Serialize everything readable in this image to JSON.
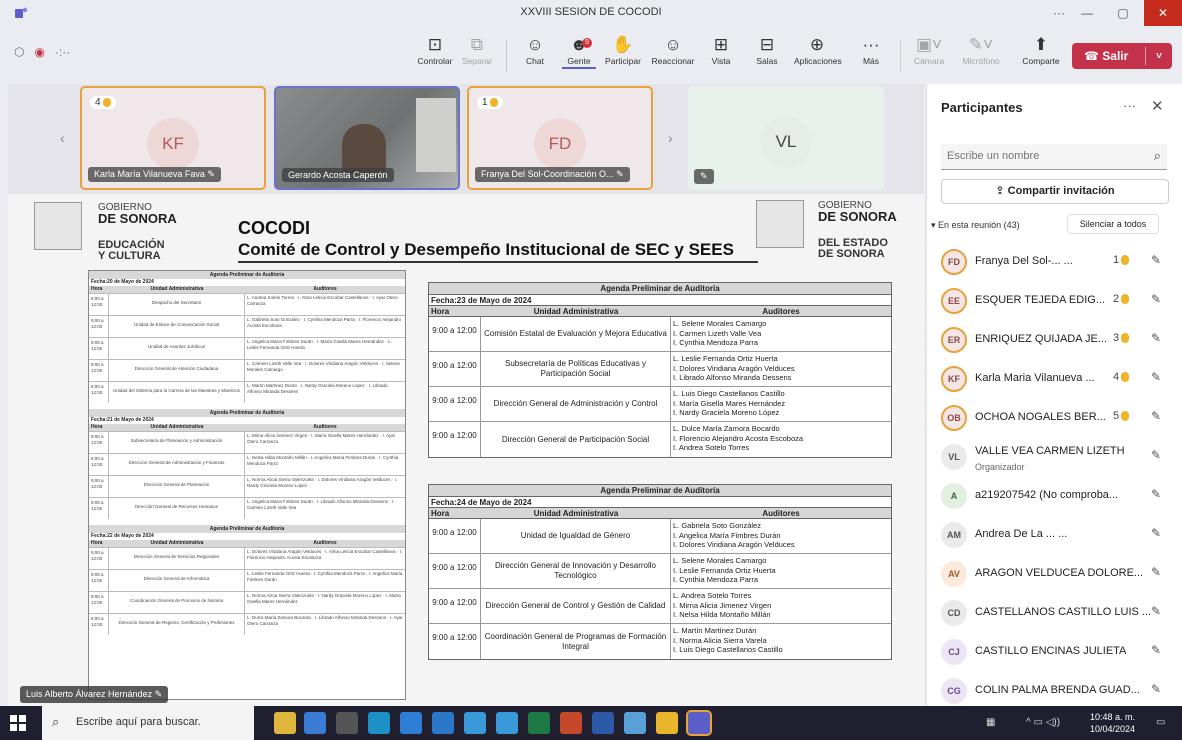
{
  "window": {
    "title": "XXVIII SESION DE COCODI",
    "controls": {
      "more": "···",
      "minimize": "—",
      "restore": "▢",
      "close": "✕"
    }
  },
  "toolbar": {
    "timer": "·:··",
    "buttons": [
      {
        "label": "Controlar",
        "icon": "control-icon"
      },
      {
        "label": "Separar",
        "icon": "popout-icon"
      },
      {
        "label": "Chat",
        "icon": "chat-icon"
      },
      {
        "label": "Gente",
        "icon": "people-icon"
      },
      {
        "label": "Participar",
        "icon": "raise-hand-icon"
      },
      {
        "label": "Reaccionar",
        "icon": "react-icon"
      },
      {
        "label": "Vista",
        "icon": "view-icon"
      },
      {
        "label": "Salas",
        "icon": "rooms-icon"
      },
      {
        "label": "Aplicaciones",
        "icon": "apps-icon"
      },
      {
        "label": "Más",
        "icon": "more-icon"
      },
      {
        "label": "Cámara",
        "icon": "camera-icon"
      },
      {
        "label": "Micrófono",
        "icon": "mic-icon"
      },
      {
        "label": "Comparte",
        "icon": "share-icon"
      }
    ],
    "people_badge": "9",
    "leave": "Salir"
  },
  "tiles": [
    {
      "initials": "KF",
      "name": "Karla María Vilanueva Fava",
      "hand": "4"
    },
    {
      "initials": "",
      "name": "Gerardo Acosta Caperón",
      "hand": ""
    },
    {
      "initials": "FD",
      "name": "Franya Del Sol-Coordinación O...",
      "hand": "1"
    },
    {
      "initials": "VL",
      "name": "",
      "hand": ""
    }
  ],
  "document": {
    "gov_left_1": "GOBIERNO",
    "gov_left_2": "DE SONORA",
    "org_left_1": "EDUCACIÓN",
    "org_left_2": "Y CULTURA",
    "title": "COCODI",
    "subtitle": "Comité de Control y Desempeño Institucional de SEC y SEES",
    "gov_right_1": "GOBIERNO",
    "gov_right_2": "DE SONORA",
    "org_right_1": "DEL ESTADO",
    "org_right_2": "DE SONORA",
    "mini_agenda_title": "Agenda Preliminar de Auditoría",
    "mini_sections": [
      {
        "date": "Fecha:20 de Mayo de 2024",
        "rows": [
          {
            "hour": "9:00 a 12:00",
            "unit": "Despacho del Secretario",
            "auditors": "L. Andrea Sotelo Torres · I. Alma Leticia Escobar Castellanos · I. Ayar Otero Carranza"
          },
          {
            "hour": "9:00 a 12:00",
            "unit": "Unidad de Enlace de Comunicación Social",
            "auditors": "L. Gabriela Soto González · I. Cynthia Mendoza Parra · I. Florencio Alejandro Acosta Escoboza"
          },
          {
            "hour": "9:00 a 12:00",
            "unit": "Unidad de Asuntos Jurídicos",
            "auditors": "L. Angelica María Fimbres Durán · I. María Gisella Mares Hernández · L. Leslie Fernanda Ortiz Huerta"
          },
          {
            "hour": "9:00 a 12:00",
            "unit": "Dirección General de Atención Ciudadana",
            "auditors": "L. Carmen Lizeth Valle Vea · I. Dolores Viridiana Aragón Velduces · I. Selene Morales Camargo"
          },
          {
            "hour": "9:00 a 12:00",
            "unit": "Unidad del Sistema para la Carrera de las Maestras y Maestros",
            "auditors": "L. Martín Martínez Durán · I. Nardy Graciela Moreno López · I. Librado Alfonso Miranda Dessens"
          }
        ]
      },
      {
        "date": "Fecha:21 de Mayo de 2024",
        "rows": [
          {
            "hour": "9:00 a 12:00",
            "unit": "Subsecretaría de Planeación y Administración",
            "auditors": "L. Mirna Alicia Jiménez Virgen · I. María Gisella Mares Hernández · I. Ayar Otero Carranza"
          },
          {
            "hour": "9:00 a 12:00",
            "unit": "Dirección General de Administración y Finanzas",
            "auditors": "L. Nelsa Hilda Montaño Millán · I. Angelica María Fimbres Durán · I. Cynthia Mendoza Parra"
          },
          {
            "hour": "9:00 a 12:00",
            "unit": "Dirección General de Planeación",
            "auditors": "L. Norma Alicia Sierra Valenzuela · I. Dolores Viridiana Aragón Velduces · I. Nardy Graciela Moreno López"
          },
          {
            "hour": "9:00 a 12:00",
            "unit": "Dirección General de Recursos Humanos",
            "auditors": "L. Angelica María Fimbres Durán · I. Librado Alfonso Miranda Dessens · I. Carmen Lizeth Valle Vea"
          }
        ]
      },
      {
        "date": "Fecha:22 de Mayo de 2024",
        "rows": [
          {
            "hour": "9:00 a 12:00",
            "unit": "Dirección General de Servicios Regionales",
            "auditors": "L. Dolores Viridiana Aragón Velduces · I. Alma Leticia Escobar Castellanos · I. Florencio Alejandro Acosta Escoboza"
          },
          {
            "hour": "9:00 a 12:00",
            "unit": "Dirección General de Informática",
            "auditors": "L. Leslie Fernanda Ortiz Huerta · I. Cynthia Mendoza Parra · I. Angelica María Fimbres Durán"
          },
          {
            "hour": "9:00 a 12:00",
            "unit": "Coordinación General de Procesos de Nómina",
            "auditors": "L. Norma Alicia Sierra Valenzuela · I. Nardy Graciela Moreno López · I. María Gisella Mares Hernández"
          },
          {
            "hour": "9:00 a 12:00",
            "unit": "Dirección General de Registro, Certificación y Profesiones",
            "auditors": "L. Dulce María Zamora Bocardo · I. Librado Alfonso Miranda Dessens · I. Ayar Otero Carranza"
          }
        ]
      }
    ],
    "agenda_23": {
      "title": "Agenda Preliminar de Auditoría",
      "date": "Fecha:23 de Mayo de 2024",
      "cols": [
        "Hora",
        "Unidad Administrativa",
        "Auditores"
      ],
      "rows": [
        {
          "hour": "9:00 a 12:00",
          "unit": "Comisión Estatal de Evaluación y Mejora Educativa",
          "auditors": [
            "L. Selene Morales Camargo",
            "I. Carmen Lizeth Valle Vea",
            "I. Cynthia Mendoza Parra"
          ]
        },
        {
          "hour": "9:00 a 12:00",
          "unit": "Subsecretaría de Políticas Educativas y Participación Social",
          "auditors": [
            "L. Leslie Fernanda Ortiz Huerta",
            "I. Dolores Viridiana Aragón Velduces",
            "I. Librado Alfonso Miranda Dessens"
          ]
        },
        {
          "hour": "9:00 a 12:00",
          "unit": "Dirección General de Administración y Control",
          "auditors": [
            "L. Luis Diego Castellanos Castillo",
            "I. María Gisella Mares Hernández",
            "I. Nardy Graciela Moreno López"
          ]
        },
        {
          "hour": "9:00 a 12:00",
          "unit": "Dirección General de Participación Social",
          "auditors": [
            "L. Dulce María Zamora Bocardo",
            "I. Florencio Alejandro Acosta Escoboza",
            "I. Andrea Sotelo Torres"
          ]
        }
      ]
    },
    "agenda_24": {
      "title": "Agenda Preliminar de Auditoría",
      "date": "Fecha:24 de Mayo de 2024",
      "cols": [
        "Hora",
        "Unidad Administrativa",
        "Auditores"
      ],
      "rows": [
        {
          "hour": "9:00 a 12:00",
          "unit": "Unidad de Igualdad de Género",
          "auditors": [
            "L. Gabriela Soto González",
            "I. Angelica María Fimbres Durán",
            "I. Dolores Viridiana Aragón Velduces"
          ]
        },
        {
          "hour": "9:00 a 12:00",
          "unit": "Dirección General de Innovación y Desarrollo Tecnológico",
          "auditors": [
            "L. Selene Morales Camargo",
            "I. Leslie Fernanda Ortiz Huerta",
            "I. Cynthia Mendoza Parra"
          ]
        },
        {
          "hour": "9:00 a 12:00",
          "unit": "Dirección General de Control y Gestión de Calidad",
          "auditors": [
            "L. Andrea Sotelo Torres",
            "I. Mirna Alicia Jimenez Virgen",
            "I. Nelsa Hilda Montaño Millán"
          ]
        },
        {
          "hour": "9:00 a 12:00",
          "unit": "Coordinación General de Programas de Formación Integral",
          "auditors": [
            "L. Martín Martínez Durán",
            "I. Norma Alicia Sierra Varela",
            "I. Luis Diego Castellanos Castillo"
          ]
        }
      ]
    },
    "presenter": "Luis Alberto Álvarez Hernández"
  },
  "panel": {
    "title": "Participantes",
    "search_placeholder": "Escribe un nombre",
    "invite": "Compartir invitación",
    "section": "En esta reunión (43)",
    "mute_all": "Silenciar a todos",
    "people": [
      {
        "initials": "FD",
        "name": "Franya Del Sol-... ...",
        "hand": "1",
        "ring": true,
        "style": ""
      },
      {
        "initials": "EE",
        "name": "ESQUER TEJEDA EDIG...",
        "hand": "2",
        "ring": true,
        "style": ""
      },
      {
        "initials": "ER",
        "name": "ENRIQUEZ QUIJADA JE...",
        "hand": "3",
        "ring": true,
        "style": ""
      },
      {
        "initials": "KF",
        "name": "Karla Maria Vilanueva ...",
        "hand": "4",
        "ring": true,
        "style": ""
      },
      {
        "initials": "OB",
        "name": "OCHOA NOGALES BER...",
        "hand": "5",
        "ring": true,
        "style": ""
      },
      {
        "initials": "VL",
        "name": "VALLE VEA CARMEN LIZETH",
        "role": "Organizador",
        "hand": "",
        "ring": false,
        "style": "gray"
      },
      {
        "initials": "A",
        "name": "a219207542 (No comproba...",
        "hand": "",
        "ring": false,
        "style": "green"
      },
      {
        "initials": "AM",
        "name": "Andrea De La ... ...",
        "hand": "",
        "ring": false,
        "style": "gray"
      },
      {
        "initials": "AV",
        "name": "ARAGON VELDUCEA DOLORE...",
        "hand": "",
        "ring": false,
        "style": "orange"
      },
      {
        "initials": "CD",
        "name": "CASTELLANOS CASTILLO LUIS ...",
        "hand": "",
        "ring": false,
        "style": "gray"
      },
      {
        "initials": "CJ",
        "name": "CASTILLO ENCINAS JULIETA",
        "hand": "",
        "ring": false,
        "style": "purple"
      },
      {
        "initials": "CG",
        "name": "COLIN PALMA BRENDA GUAD...",
        "hand": "",
        "ring": false,
        "style": "purple"
      }
    ]
  },
  "taskbar": {
    "search": "Escribe aquí para buscar.",
    "time": "10:48 a. m.",
    "date": "10/04/2024"
  },
  "colors": {
    "accent": "#5b5fc7",
    "leave": "#c4314b",
    "raised_hand": "#f0b429"
  }
}
